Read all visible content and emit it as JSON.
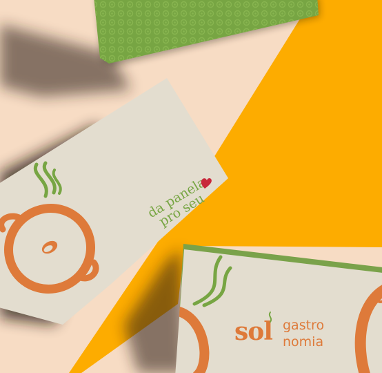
{
  "colors": {
    "background": "#f7dcc4",
    "accent_yellow": "#fdac00",
    "card": "#e3ddcf",
    "green": "#77a543",
    "orange": "#de7a3a",
    "heart": "#c8283b"
  },
  "card_middle": {
    "slogan_line1": "da panela",
    "slogan_line2": "pro seu",
    "heart_icon": "heart"
  },
  "card_bottom": {
    "logo_word": "sol",
    "logo_line1": "gastro",
    "logo_line2": "nomia"
  },
  "icons": [
    "steam-icon",
    "pot-icon",
    "heart-icon"
  ]
}
